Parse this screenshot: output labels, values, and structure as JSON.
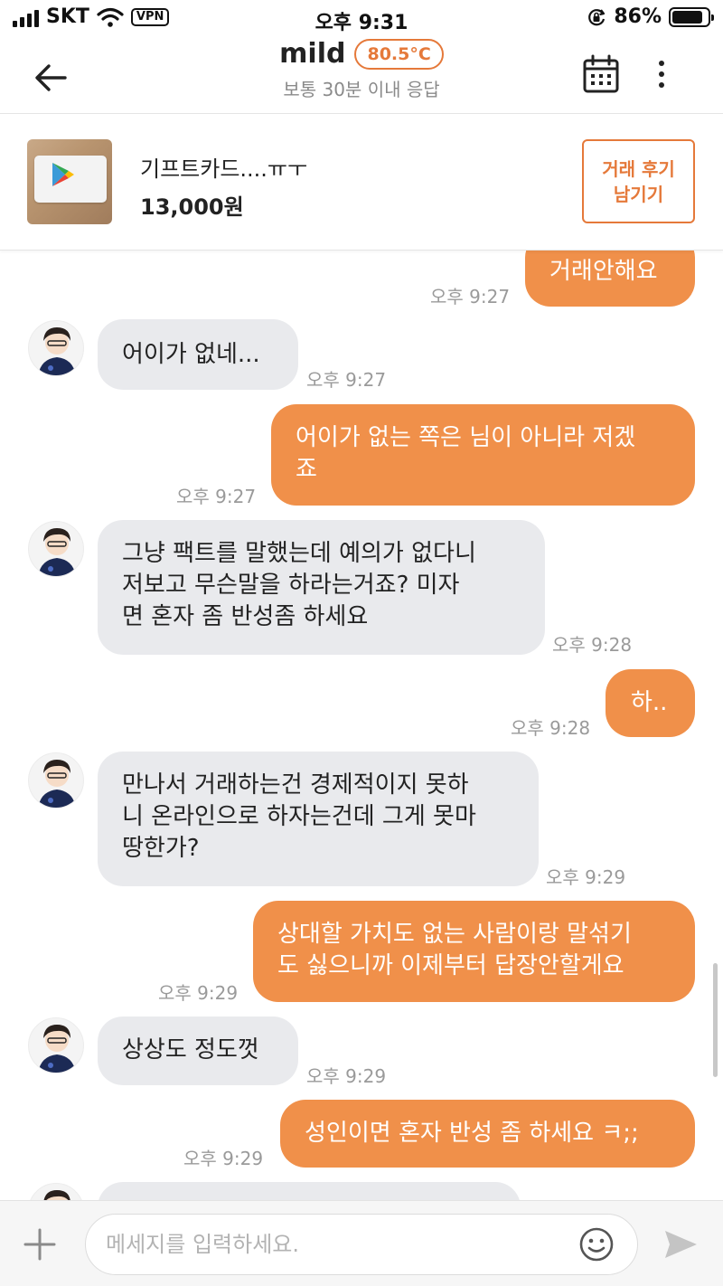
{
  "status_bar": {
    "carrier": "SKT",
    "vpn": "VPN",
    "time": "오후 9:31",
    "battery": "86%",
    "battery_level": 0.86
  },
  "header": {
    "name": "mild",
    "temperature": "80.5°C",
    "response_time": "보통 30분 이내 응답"
  },
  "product": {
    "title": "기프트카드....ㅠㅜ",
    "price": "13,000원",
    "review_button_line1": "거래 후기",
    "review_button_line2": "남기기"
  },
  "messages": [
    {
      "sender": "me",
      "text": "거래안해요",
      "time": "오후 9:27"
    },
    {
      "sender": "other",
      "text": "어이가 없네...",
      "time": "오후 9:27"
    },
    {
      "sender": "me",
      "text": "어이가 없는 쪽은 님이 아니라 저겠\n죠",
      "time": "오후 9:27"
    },
    {
      "sender": "other",
      "text": "그냥 팩트를 말했는데 예의가 없다니\n저보고 무슨말을 하라는거죠? 미자\n면 혼자 좀 반성좀 하세요",
      "time": "오후 9:28"
    },
    {
      "sender": "me",
      "text": "하..",
      "time": "오후 9:28"
    },
    {
      "sender": "other",
      "text": "만나서 거래하는건 경제적이지 못하\n니 온라인으로 하자는건데 그게 못마\n땅한가?",
      "time": "오후 9:29"
    },
    {
      "sender": "me",
      "text": "상대할 가치도 없는 사람이랑 말섞기\n도 싫으니까 이제부터 답장안할게요",
      "time": "오후 9:29"
    },
    {
      "sender": "other",
      "text": "상상도 정도껏",
      "time": "오후 9:29"
    },
    {
      "sender": "me",
      "text": "성인이면 혼자 반성 좀 하세요 ㅋ;;",
      "time": "오후 9:29"
    }
  ],
  "input": {
    "placeholder": "메세지를 입력하세요."
  },
  "colors": {
    "accent": "#e5793a",
    "outgoing_bubble": "#f0904a",
    "incoming_bubble": "#e9eaed"
  }
}
